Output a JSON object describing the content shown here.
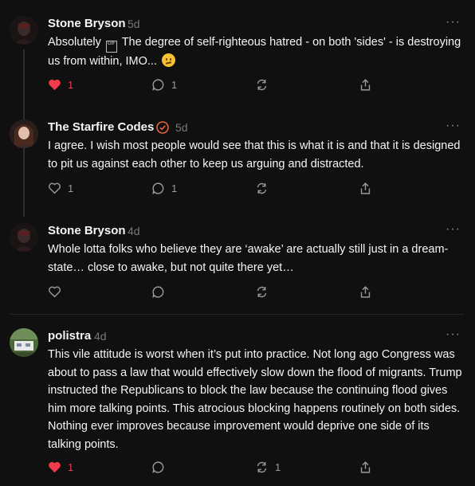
{
  "comments": [
    {
      "author": "Stone Bryson",
      "time": "5d",
      "text": "Absolutely",
      "text_rest": " The degree of self-righteous hatred - on both 'sides' - is destroying us from within, IMO...",
      "emoji_square": "GIF",
      "like_count": "1",
      "reply_count": "1",
      "repost_count": "",
      "liked": true
    },
    {
      "author": "The Starfire Codes",
      "time": "5d",
      "text": "I agree. I wish most people would see that this is what it is and that it is designed to pit us against each other to keep us arguing and distracted.",
      "like_count": "1",
      "reply_count": "1",
      "repost_count": "",
      "liked": false,
      "badge_color": "#e8643c"
    },
    {
      "author": "Stone Bryson",
      "time": "4d",
      "text": "Whole lotta folks who believe they are ‘awake’ are actually still just in a dream-state… close to awake, but not quite there yet…",
      "like_count": "",
      "reply_count": "",
      "repost_count": "",
      "liked": false
    },
    {
      "author": "polistra",
      "time": "4d",
      "text": "This vile attitude is worst when it’s put into practice. Not long ago Congress was about to pass a law that would effectively slow down the flood of migrants. Trump instructed the Republicans to block the law because the continuing flood gives him more talking points. This atrocious blocking happens routinely on both sides. Nothing ever improves because improvement would deprive one side of its talking points.",
      "like_count": "1",
      "reply_count": "",
      "repost_count": "1",
      "liked": true
    }
  ],
  "more_label": "···",
  "colors": {
    "like_active": "#f33a4a",
    "muted": "#9a9a9a",
    "background": "#101010"
  }
}
